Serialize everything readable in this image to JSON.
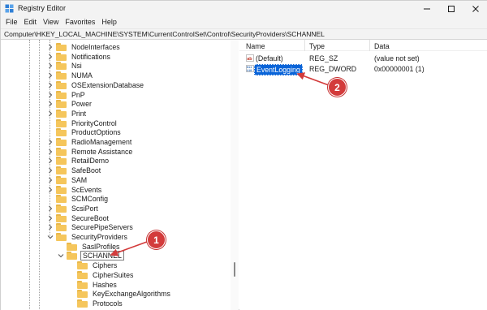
{
  "window": {
    "title": "Registry Editor",
    "controls": {
      "minimize_icon": "minimize-icon",
      "maximize_icon": "maximize-icon",
      "close_icon": "close-icon"
    }
  },
  "menu": [
    "File",
    "Edit",
    "View",
    "Favorites",
    "Help"
  ],
  "address": "Computer\\HKEY_LOCAL_MACHINE\\SYSTEM\\CurrentControlSet\\Control\\SecurityProviders\\SCHANNEL",
  "tree": {
    "items": [
      {
        "label": "NodeInterfaces",
        "level": 0,
        "expander": "right",
        "selected": false
      },
      {
        "label": "Notifications",
        "level": 0,
        "expander": "right",
        "selected": false
      },
      {
        "label": "Nsi",
        "level": 0,
        "expander": "right",
        "selected": false
      },
      {
        "label": "NUMA",
        "level": 0,
        "expander": "right",
        "selected": false
      },
      {
        "label": "OSExtensionDatabase",
        "level": 0,
        "expander": "right",
        "selected": false
      },
      {
        "label": "PnP",
        "level": 0,
        "expander": "right",
        "selected": false
      },
      {
        "label": "Power",
        "level": 0,
        "expander": "right",
        "selected": false
      },
      {
        "label": "Print",
        "level": 0,
        "expander": "right",
        "selected": false
      },
      {
        "label": "PriorityControl",
        "level": 0,
        "expander": "none",
        "selected": false
      },
      {
        "label": "ProductOptions",
        "level": 0,
        "expander": "none",
        "selected": false
      },
      {
        "label": "RadioManagement",
        "level": 0,
        "expander": "right",
        "selected": false
      },
      {
        "label": "Remote Assistance",
        "level": 0,
        "expander": "right",
        "selected": false
      },
      {
        "label": "RetailDemo",
        "level": 0,
        "expander": "right",
        "selected": false
      },
      {
        "label": "SafeBoot",
        "level": 0,
        "expander": "right",
        "selected": false
      },
      {
        "label": "SAM",
        "level": 0,
        "expander": "right",
        "selected": false
      },
      {
        "label": "ScEvents",
        "level": 0,
        "expander": "right",
        "selected": false
      },
      {
        "label": "SCMConfig",
        "level": 0,
        "expander": "none",
        "selected": false
      },
      {
        "label": "ScsiPort",
        "level": 0,
        "expander": "right",
        "selected": false
      },
      {
        "label": "SecureBoot",
        "level": 0,
        "expander": "right",
        "selected": false
      },
      {
        "label": "SecurePipeServers",
        "level": 0,
        "expander": "right",
        "selected": false
      },
      {
        "label": "SecurityProviders",
        "level": 0,
        "expander": "down",
        "selected": false
      },
      {
        "label": "SaslProfiles",
        "level": 1,
        "expander": "none",
        "selected": false
      },
      {
        "label": "SCHANNEL",
        "level": 1,
        "expander": "down",
        "selected": true
      },
      {
        "label": "Ciphers",
        "level": 2,
        "expander": "none",
        "selected": false
      },
      {
        "label": "CipherSuites",
        "level": 2,
        "expander": "none",
        "selected": false
      },
      {
        "label": "Hashes",
        "level": 2,
        "expander": "none",
        "selected": false
      },
      {
        "label": "KeyExchangeAlgorithms",
        "level": 2,
        "expander": "none",
        "selected": false
      },
      {
        "label": "Protocols",
        "level": 2,
        "expander": "none",
        "selected": false
      }
    ]
  },
  "list": {
    "headers": {
      "name": "Name",
      "type": "Type",
      "data": "Data"
    },
    "rows": [
      {
        "name": "(Default)",
        "type": "REG_SZ",
        "data": "(value not set)",
        "icon": "string-value-icon",
        "selected": false
      },
      {
        "name": "EventLogging",
        "type": "REG_DWORD",
        "data": "0x00000001 (1)",
        "icon": "dword-value-icon",
        "selected": true
      }
    ]
  },
  "annotations": [
    {
      "label": "1"
    },
    {
      "label": "2"
    }
  ],
  "colors": {
    "selection": "#0a64d8",
    "folder": "#f5c65c",
    "annotation": "#d33b3b"
  }
}
